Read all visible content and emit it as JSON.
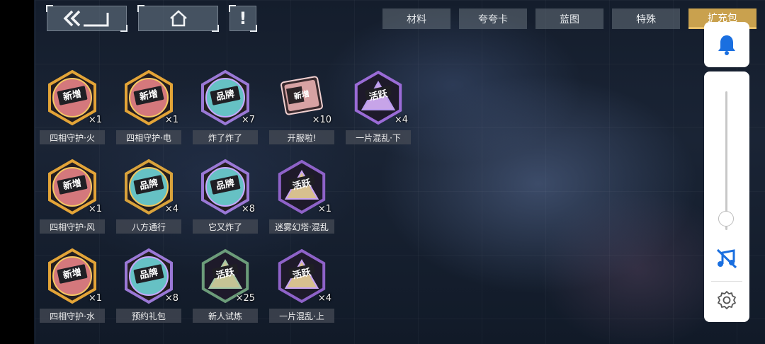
{
  "top_buttons": {
    "back_icon": "double-chevron-back-icon",
    "home_icon": "home-icon",
    "alert_label": "!"
  },
  "tabs": [
    {
      "label": "材料",
      "active": false
    },
    {
      "label": "夸夸卡",
      "active": false
    },
    {
      "label": "蓝图",
      "active": false
    },
    {
      "label": "特殊",
      "active": false
    },
    {
      "label": "扩充包",
      "active": true
    }
  ],
  "items": [
    {
      "name": "四相守护·火",
      "count": "×1",
      "badge_text": "新增",
      "type": "new"
    },
    {
      "name": "四相守护·电",
      "count": "×1",
      "badge_text": "新增",
      "type": "new"
    },
    {
      "name": "炸了炸了",
      "count": "×7",
      "badge_text": "品牌",
      "type": "brand"
    },
    {
      "name": "开服啦!",
      "count": "×10",
      "badge_text": "新增",
      "type": "ticket"
    },
    {
      "name": "一片混乱·下",
      "count": "×4",
      "badge_text": "活跃",
      "type": "active"
    },
    {
      "name": "四相守护·风",
      "count": "×1",
      "badge_text": "新增",
      "type": "new"
    },
    {
      "name": "八方通行",
      "count": "×4",
      "badge_text": "品牌",
      "type": "brand_gold"
    },
    {
      "name": "它又炸了",
      "count": "×8",
      "badge_text": "品牌",
      "type": "brand"
    },
    {
      "name": "迷雾幻塔·混乱",
      "count": "×1",
      "badge_text": "活跃",
      "type": "active_gold"
    },
    {
      "name": "四相守护·水",
      "count": "×1",
      "badge_text": "新增",
      "type": "new"
    },
    {
      "name": "预约礼包",
      "count": "×8",
      "badge_text": "品牌",
      "type": "brand"
    },
    {
      "name": "新人试炼",
      "count": "×25",
      "badge_text": "活跃",
      "type": "active_green"
    },
    {
      "name": "一片混乱·上",
      "count": "×4",
      "badge_text": "活跃",
      "type": "active_gold"
    }
  ],
  "right_panel": {
    "notify_icon": "bell-icon",
    "volume_level": 0.08,
    "music_icon": "music-off-icon",
    "settings_icon": "gear-icon"
  },
  "colors": {
    "active_tab": "#c9a14e",
    "accent_blue": "#1a6fe0",
    "label_bg": "#464b55"
  }
}
